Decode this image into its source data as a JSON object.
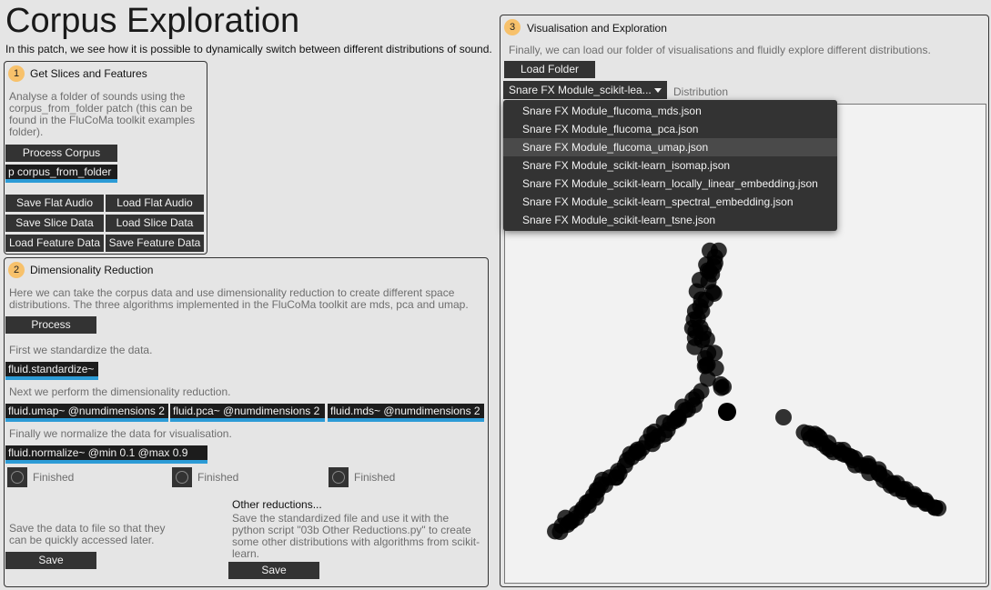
{
  "page": {
    "title": "Corpus Exploration",
    "intro": "In this patch, we see how it is possible to dynamically switch between different distributions of sound."
  },
  "panel1": {
    "step": "1",
    "title": "Get Slices and Features",
    "desc": "Analyse a folder of sounds using the corpus_from_folder patch (this can be found in the FluCoMa toolkit examples folder).",
    "process_btn": "Process Corpus",
    "subpatch": "p corpus_from_folder",
    "buttons": [
      "Save Flat Audio",
      "Load Flat Audio",
      "Save Slice Data",
      "Load Slice Data",
      "Load Feature Data",
      "Save Feature Data"
    ]
  },
  "panel2": {
    "step": "2",
    "title": "Dimensionality Reduction",
    "desc": "Here we can take the corpus data and use dimensionality reduction to create different space distributions. The three algorithms implemented in the FluCoMa toolkit are mds, pca and umap.",
    "process_btn": "Process",
    "std_text": "First we standardize the data.",
    "std_obj": "fluid.standardize~",
    "red_text": "Next we perform the dimensionality reduction.",
    "reducers": [
      "fluid.umap~ @numdimensions 2",
      "fluid.pca~ @numdimensions 2",
      "fluid.mds~ @numdimensions 2"
    ],
    "norm_text": "Finally we normalize the data for visualisation.",
    "norm_obj": "fluid.normalize~ @min 0.1 @max 0.9",
    "finished": [
      "Finished",
      "Finished",
      "Finished"
    ],
    "save_text": "Save the data to file so that they can be quickly accessed later.",
    "save_btn": "Save",
    "other_title": "Other reductions...",
    "other_desc": "Save the standardized file and use it with the python script \"03b Other Reductions.py\" to create some other distributions with algorithms from scikit-learn.",
    "other_save_btn": "Save"
  },
  "panel3": {
    "step": "3",
    "title": "Visualisation and Exploration",
    "desc": "Finally, we can load our folder of visualisations and fluidly explore different distributions.",
    "load_btn": "Load Folder",
    "dropdown_value": "Snare FX Module_scikit-lea...",
    "dropdown_label": "Distribution",
    "menu_items": [
      "Snare FX Module_flucoma_mds.json",
      "Snare FX Module_flucoma_pca.json",
      "Snare FX Module_flucoma_umap.json",
      "Snare FX Module_scikit-learn_isomap.json",
      "Snare FX Module_scikit-learn_locally_linear_embedding.json",
      "Snare FX Module_scikit-learn_spectral_embedding.json",
      "Snare FX Module_scikit-learn_tsne.json"
    ],
    "menu_highlight": 2
  },
  "colors": {
    "accent_blue": "#2c9bd6",
    "step_badge": "#f7c16b",
    "button_bg": "#333333",
    "point": "#000000"
  }
}
